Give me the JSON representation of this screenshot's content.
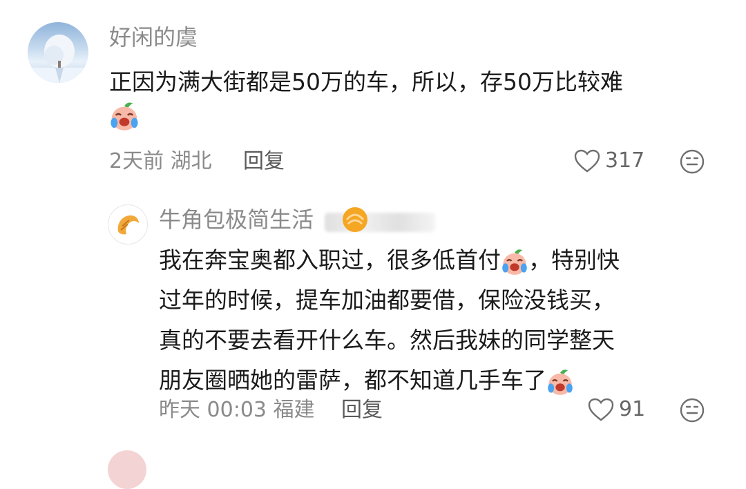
{
  "comments": [
    {
      "username": "好闲的虞",
      "text_before_emoji": "正因为满大街都是50万的车，所以，存50万比较难",
      "time": "2天前",
      "location": "湖北",
      "reply_label": "回复",
      "likes": "317",
      "emoji_icon": "crying-peach-emoji"
    },
    {
      "username": "牛角包极简生活",
      "lines": [
        "我在奔宝奥都入职过，很多低首付",
        "，特别快",
        "过年的时候，提车加油都要借，保险没钱买，",
        "真的不要去看开什么车。然后我妹的同学整天",
        "朋友圈晒她的雷萨，都不知道几手车了"
      ],
      "time": "昨天 00:03",
      "location": "福建",
      "reply_label": "回复",
      "likes": "91",
      "emoji_icon": "crying-peach-emoji"
    }
  ],
  "colors": {
    "text": "#1b1b1b",
    "meta": "#8a8a8a",
    "badge_orange": "#f5a623"
  }
}
